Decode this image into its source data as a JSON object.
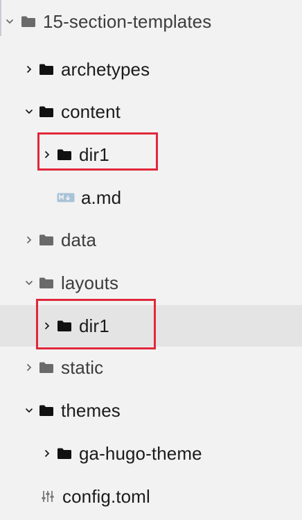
{
  "tree": {
    "root": {
      "label": "15-section-templates",
      "expanded": true
    },
    "items": [
      {
        "label": "archetypes",
        "type": "folder",
        "expanded": false
      },
      {
        "label": "content",
        "type": "folder",
        "expanded": true
      },
      {
        "label": "dir1",
        "type": "folder",
        "expanded": false,
        "highlighted": true
      },
      {
        "label": "a.md",
        "type": "file",
        "icon": "markdown-file-icon"
      },
      {
        "label": "data",
        "type": "folder",
        "expanded": false
      },
      {
        "label": "layouts",
        "type": "folder",
        "expanded": true
      },
      {
        "label": "dir1",
        "type": "folder",
        "expanded": false,
        "highlighted": true,
        "selected": true
      },
      {
        "label": "static",
        "type": "folder",
        "expanded": false
      },
      {
        "label": "themes",
        "type": "folder",
        "expanded": true
      },
      {
        "label": "ga-hugo-theme",
        "type": "folder",
        "expanded": false
      },
      {
        "label": "config.toml",
        "type": "file",
        "icon": "config-file-icon"
      }
    ]
  },
  "colors": {
    "background": "#f2f2f2",
    "selected_row": "#e4e4e4",
    "highlight_border": "#e0273a",
    "folder_dark": "#111111",
    "folder_gray": "#6a6a6a"
  }
}
